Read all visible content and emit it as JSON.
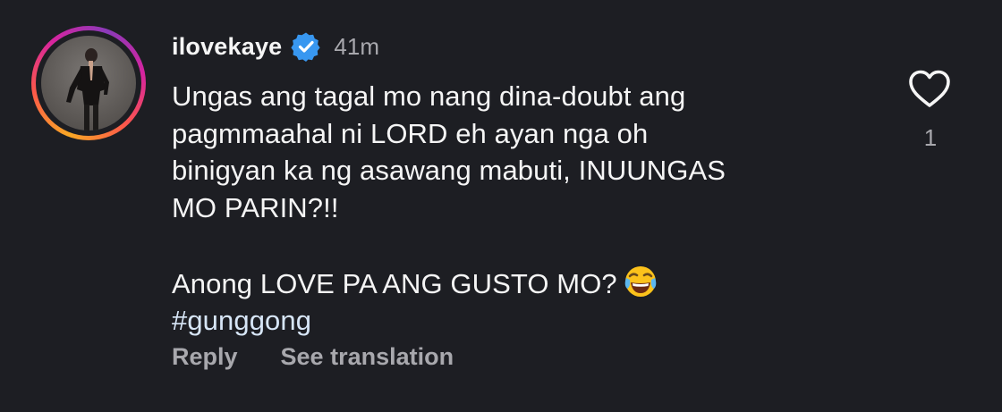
{
  "comment": {
    "username": "ilovekaye",
    "verified": true,
    "timestamp": "41m",
    "body": {
      "line1": "Ungas ang tagal mo nang dina-doubt ang",
      "line2": "pagmmaahal ni LORD eh ayan nga oh",
      "line3": "binigyan ka ng asawang mabuti, INUUNGAS",
      "line4": "MO PARIN?!!",
      "line5": "Anong LOVE PA ANG GUSTO MO?",
      "emoji": "face-with-tears-of-joy",
      "hashtag": "#gunggong"
    },
    "actions": {
      "reply_label": "Reply",
      "translate_label": "See translation"
    },
    "likes": {
      "count": "1",
      "icon": "heart-outline-icon"
    }
  },
  "colors": {
    "background": "#1d1e23",
    "text": "#f5f5f5",
    "secondary_text": "#a8a8ad",
    "hashtag": "#d7e6f7",
    "verified_badge": "#3897f0"
  }
}
